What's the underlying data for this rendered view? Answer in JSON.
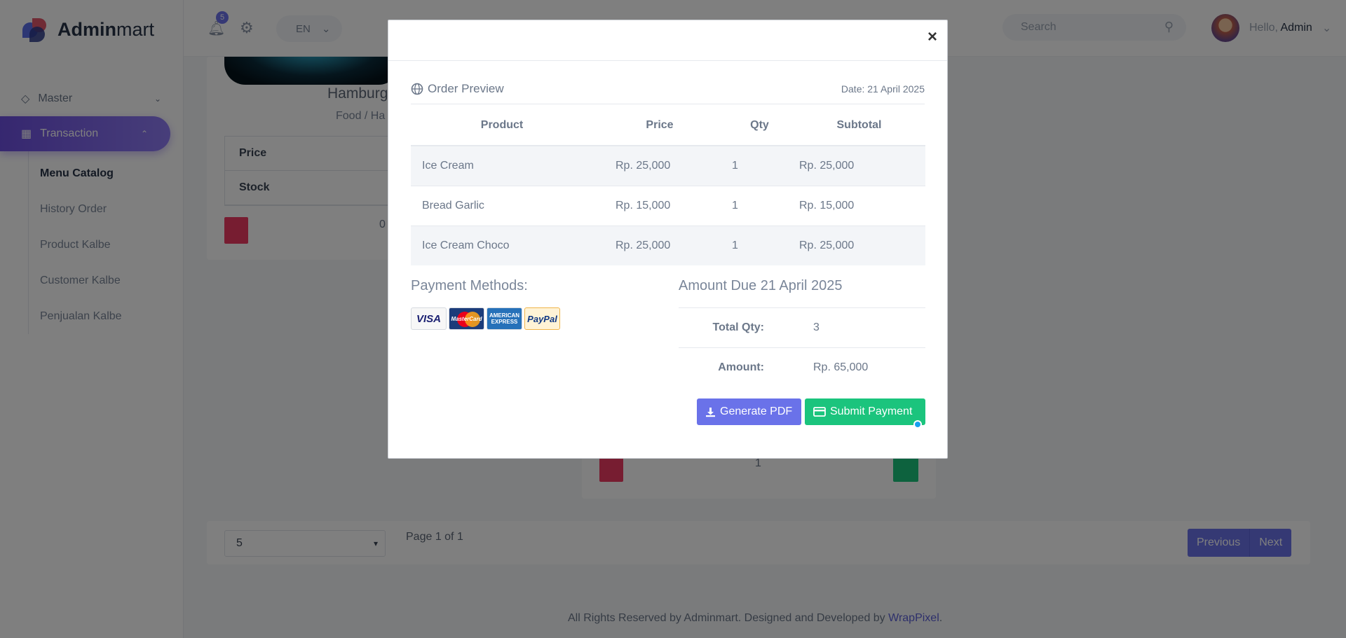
{
  "brand": {
    "bold": "Admin",
    "light": "mart"
  },
  "sidebar": {
    "items": [
      {
        "label": "Master",
        "icon": "tag-icon"
      },
      {
        "label": "Transaction",
        "icon": "calendar-icon"
      }
    ],
    "sub_items": [
      "Menu Catalog",
      "History Order",
      "Product Kalbe",
      "Customer Kalbe",
      "Penjualan Kalbe"
    ]
  },
  "topbar": {
    "notification_count": "5",
    "language": "EN",
    "search_placeholder": "Search",
    "greeting": "Hello,",
    "username": "Admin"
  },
  "background": {
    "product_title": "Hamburg",
    "product_category": "Food / Ha",
    "spec_labels": [
      "Price",
      "Stock"
    ],
    "qty_left": "0",
    "qty_mid": "1",
    "page_size": "5",
    "page_info": "Page 1 of 1",
    "prev_label": "Previous",
    "next_label": "Next",
    "footer_text": "All Rights Reserved by Adminmart. Designed and Developed by",
    "footer_link": "WrapPixel",
    "footer_end": "."
  },
  "modal": {
    "close_label": "×",
    "title": "Order Preview",
    "date": "Date: 21 April 2025",
    "columns": [
      "Product",
      "Price",
      "Qty",
      "Subtotal"
    ],
    "rows": [
      {
        "product": "Ice Cream",
        "price": "Rp. 25,000",
        "qty": "1",
        "subtotal": "Rp. 25,000"
      },
      {
        "product": "Bread Garlic",
        "price": "Rp. 15,000",
        "qty": "1",
        "subtotal": "Rp. 15,000"
      },
      {
        "product": "Ice Cream Choco",
        "price": "Rp. 25,000",
        "qty": "1",
        "subtotal": "Rp. 25,000"
      }
    ],
    "payment_title": "Payment Methods:",
    "payment_cards": {
      "visa": "VISA",
      "mastercard": "MasterCard",
      "amex": "AMERICAN EXPRESS",
      "paypal": "PayPal"
    },
    "due_title": "Amount Due 21 April 2025",
    "total_qty_label": "Total Qty:",
    "total_qty": "3",
    "amount_label": "Amount:",
    "amount": "Rp. 65,000",
    "pdf_button": "Generate PDF",
    "submit_button": "Submit Payment"
  },
  "colors": {
    "accent": "#6a72e9",
    "success": "#1bc47d",
    "danger": "#ef3b63"
  }
}
